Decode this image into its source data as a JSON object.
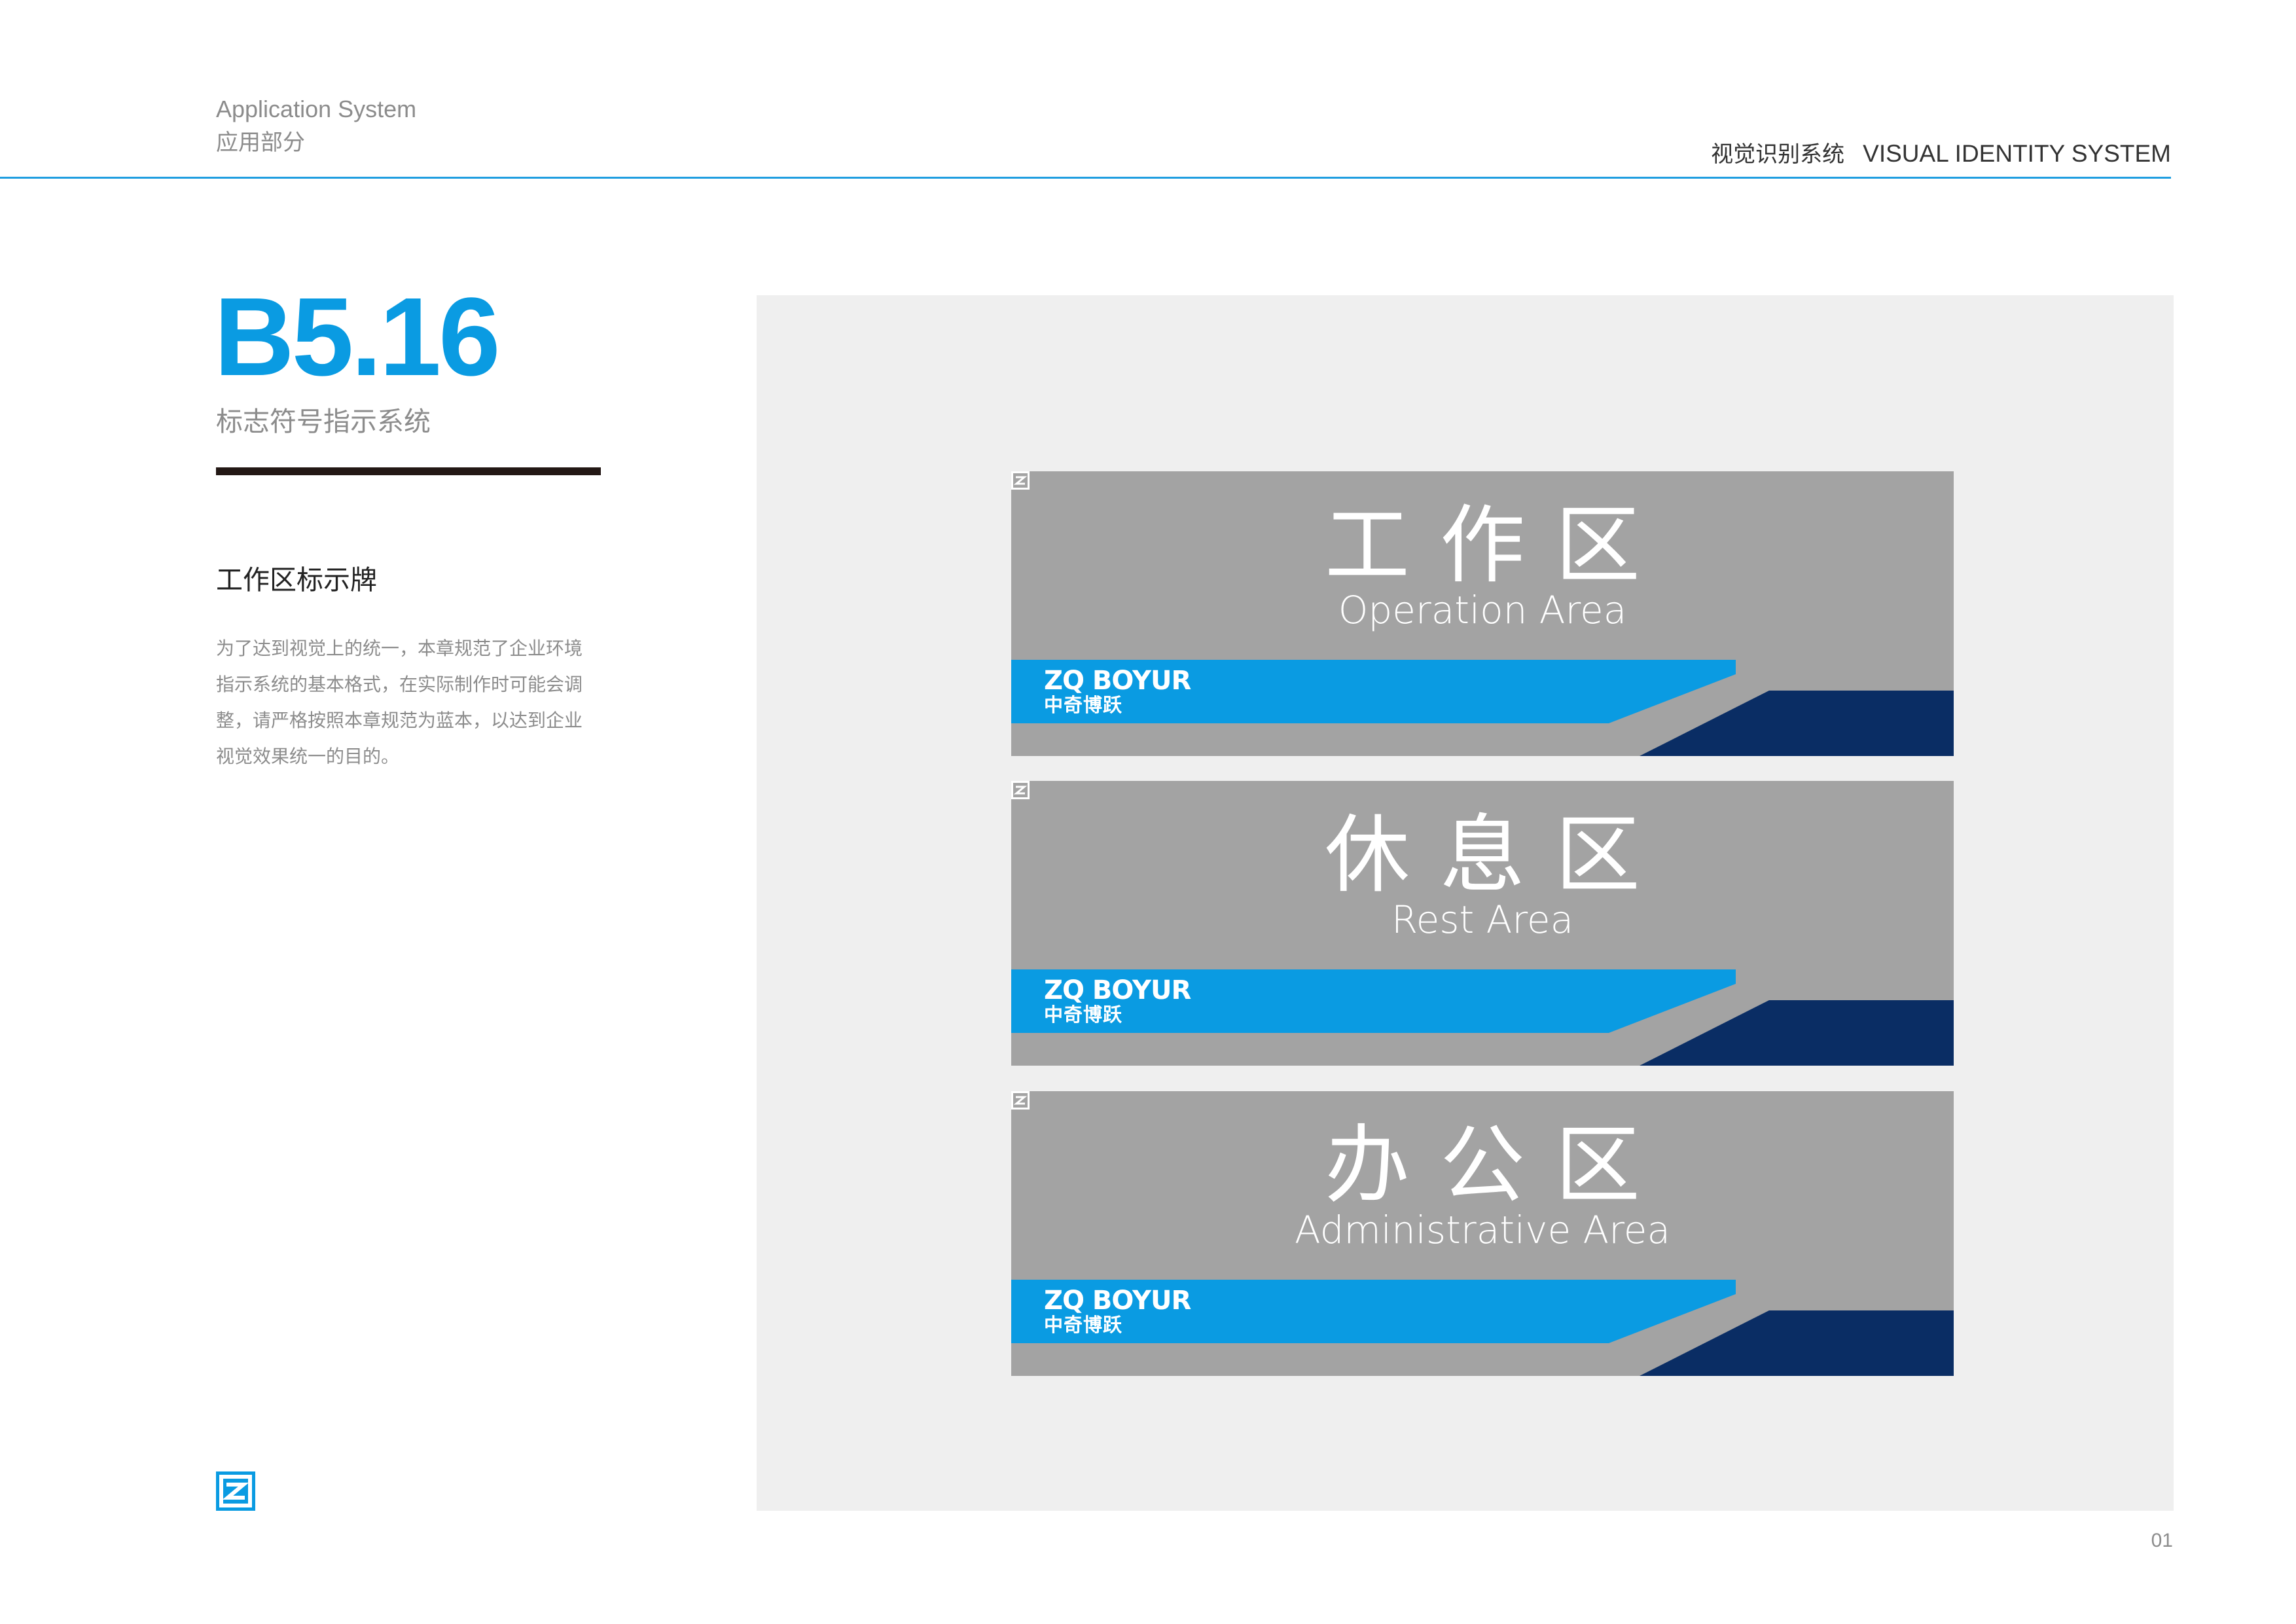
{
  "header": {
    "section_en": "Application System",
    "section_cn": "应用部分",
    "system_cn": "视觉识别系统",
    "system_en": "VISUAL IDENTITY SYSTEM"
  },
  "code": {
    "number": "B5.16",
    "title": "标志符号指示系统"
  },
  "section": {
    "title": "工作区标示牌",
    "description_lines": [
      "为了达到视觉上的统一，本章规范了企业环境",
      "指示系统的基本格式，在实际制作时可能会调",
      "整，请严格按照本章规范为蓝本，以达到企业",
      "视觉效果统一的目的。"
    ]
  },
  "signs": [
    {
      "cn": "工作区",
      "en": "Operation Area"
    },
    {
      "cn": "休息区",
      "en": "Rest Area"
    },
    {
      "cn": "办公区",
      "en": "Administrative Area"
    }
  ],
  "logo": {
    "en": "ZQ BOYUR",
    "cn": "中奇博跃"
  },
  "colors": {
    "brand_blue": "#0a9be2",
    "navy": "#0a2d64",
    "sign_gray": "#a3a3a3",
    "panel_gray": "#efefef"
  },
  "footer": {
    "page": "01"
  }
}
